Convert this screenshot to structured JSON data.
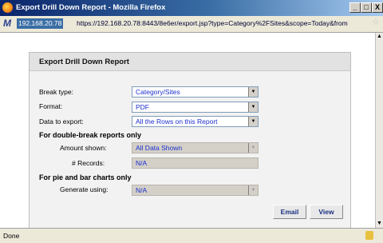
{
  "window": {
    "title": "Export Drill Down Report - Mozilla Firefox",
    "minimize": "_",
    "maximize": "□",
    "close": "X"
  },
  "address": {
    "host": "192.168.20.78",
    "url": "https://192.168.20.78:8443/8e6er/export.jsp?type=Category%2FSites&scope=Today&from"
  },
  "dialog": {
    "title": "Export Drill Down Report",
    "break_type": {
      "label": "Break type:",
      "value": "Category/Sites"
    },
    "format": {
      "label": "Format:",
      "value": "PDF"
    },
    "data_to_export": {
      "label": "Data to export:",
      "value": "All the Rows on this Report"
    },
    "double_break": {
      "heading": "For double-break reports only",
      "amount_label": "Amount shown:",
      "amount_value": "All Data Shown",
      "records_label": "# Records:",
      "records_value": "N/A"
    },
    "pie_bar": {
      "heading": "For pie and bar charts only",
      "generate_label": "Generate using:",
      "generate_value": "N/A"
    },
    "email_button": "Email",
    "view_button": "View"
  },
  "status": {
    "text": "Done"
  }
}
